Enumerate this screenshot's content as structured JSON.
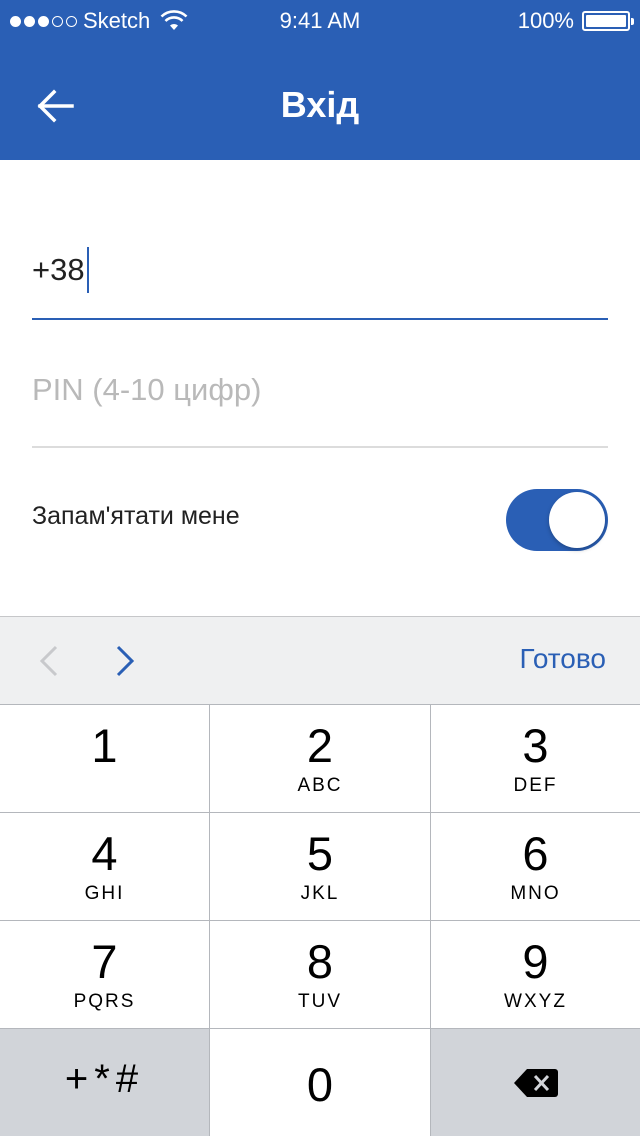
{
  "status_bar": {
    "carrier": "Sketch",
    "time": "9:41 AM",
    "battery": "100%"
  },
  "header": {
    "title": "Вхід",
    "back_icon": "arrow-left-icon"
  },
  "form": {
    "phone_value": "+38",
    "pin_placeholder": "PIN (4-10 цифр)",
    "remember_label": "Запам'ятати мене",
    "remember_on": true
  },
  "toolbar": {
    "done_label": "Готово",
    "prev_icon": "chevron-left-icon",
    "next_icon": "chevron-right-icon"
  },
  "keypad": {
    "keys": [
      {
        "num": "1",
        "letters": ""
      },
      {
        "num": "2",
        "letters": "ABC"
      },
      {
        "num": "3",
        "letters": "DEF"
      },
      {
        "num": "4",
        "letters": "GHI"
      },
      {
        "num": "5",
        "letters": "JKL"
      },
      {
        "num": "6",
        "letters": "MNO"
      },
      {
        "num": "7",
        "letters": "PQRS"
      },
      {
        "num": "8",
        "letters": "TUV"
      },
      {
        "num": "9",
        "letters": "WXYZ"
      }
    ],
    "symbols": "+*#",
    "zero": "0",
    "delete_icon": "backspace-icon"
  },
  "colors": {
    "accent": "#2a5fb5",
    "keyboard_gray": "#d1d4d9",
    "toolbar_bg": "#eff0f1"
  }
}
